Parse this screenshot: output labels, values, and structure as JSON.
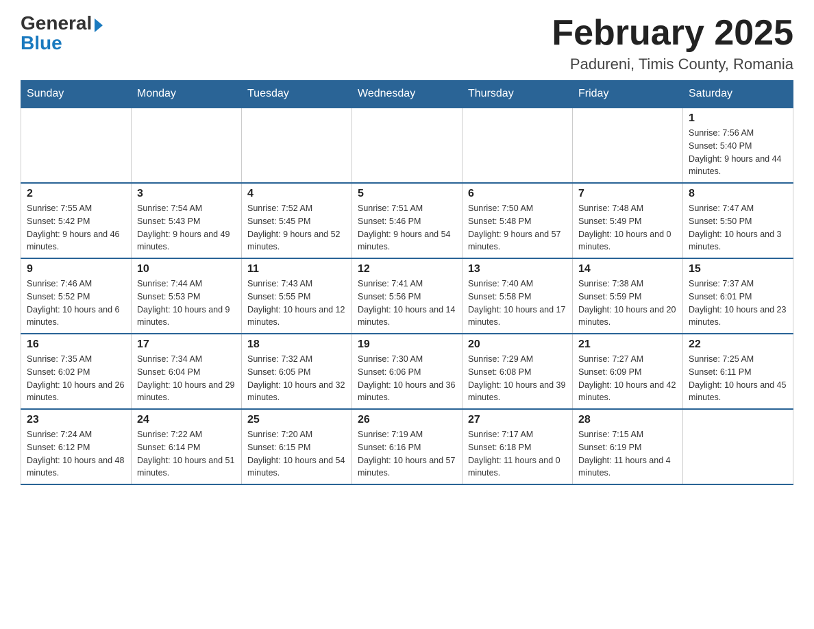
{
  "header": {
    "logo_general": "General",
    "logo_blue": "Blue",
    "month_year": "February 2025",
    "location": "Padureni, Timis County, Romania"
  },
  "weekdays": [
    "Sunday",
    "Monday",
    "Tuesday",
    "Wednesday",
    "Thursday",
    "Friday",
    "Saturday"
  ],
  "weeks": [
    [
      {
        "day": "",
        "info": ""
      },
      {
        "day": "",
        "info": ""
      },
      {
        "day": "",
        "info": ""
      },
      {
        "day": "",
        "info": ""
      },
      {
        "day": "",
        "info": ""
      },
      {
        "day": "",
        "info": ""
      },
      {
        "day": "1",
        "info": "Sunrise: 7:56 AM\nSunset: 5:40 PM\nDaylight: 9 hours and 44 minutes."
      }
    ],
    [
      {
        "day": "2",
        "info": "Sunrise: 7:55 AM\nSunset: 5:42 PM\nDaylight: 9 hours and 46 minutes."
      },
      {
        "day": "3",
        "info": "Sunrise: 7:54 AM\nSunset: 5:43 PM\nDaylight: 9 hours and 49 minutes."
      },
      {
        "day": "4",
        "info": "Sunrise: 7:52 AM\nSunset: 5:45 PM\nDaylight: 9 hours and 52 minutes."
      },
      {
        "day": "5",
        "info": "Sunrise: 7:51 AM\nSunset: 5:46 PM\nDaylight: 9 hours and 54 minutes."
      },
      {
        "day": "6",
        "info": "Sunrise: 7:50 AM\nSunset: 5:48 PM\nDaylight: 9 hours and 57 minutes."
      },
      {
        "day": "7",
        "info": "Sunrise: 7:48 AM\nSunset: 5:49 PM\nDaylight: 10 hours and 0 minutes."
      },
      {
        "day": "8",
        "info": "Sunrise: 7:47 AM\nSunset: 5:50 PM\nDaylight: 10 hours and 3 minutes."
      }
    ],
    [
      {
        "day": "9",
        "info": "Sunrise: 7:46 AM\nSunset: 5:52 PM\nDaylight: 10 hours and 6 minutes."
      },
      {
        "day": "10",
        "info": "Sunrise: 7:44 AM\nSunset: 5:53 PM\nDaylight: 10 hours and 9 minutes."
      },
      {
        "day": "11",
        "info": "Sunrise: 7:43 AM\nSunset: 5:55 PM\nDaylight: 10 hours and 12 minutes."
      },
      {
        "day": "12",
        "info": "Sunrise: 7:41 AM\nSunset: 5:56 PM\nDaylight: 10 hours and 14 minutes."
      },
      {
        "day": "13",
        "info": "Sunrise: 7:40 AM\nSunset: 5:58 PM\nDaylight: 10 hours and 17 minutes."
      },
      {
        "day": "14",
        "info": "Sunrise: 7:38 AM\nSunset: 5:59 PM\nDaylight: 10 hours and 20 minutes."
      },
      {
        "day": "15",
        "info": "Sunrise: 7:37 AM\nSunset: 6:01 PM\nDaylight: 10 hours and 23 minutes."
      }
    ],
    [
      {
        "day": "16",
        "info": "Sunrise: 7:35 AM\nSunset: 6:02 PM\nDaylight: 10 hours and 26 minutes."
      },
      {
        "day": "17",
        "info": "Sunrise: 7:34 AM\nSunset: 6:04 PM\nDaylight: 10 hours and 29 minutes."
      },
      {
        "day": "18",
        "info": "Sunrise: 7:32 AM\nSunset: 6:05 PM\nDaylight: 10 hours and 32 minutes."
      },
      {
        "day": "19",
        "info": "Sunrise: 7:30 AM\nSunset: 6:06 PM\nDaylight: 10 hours and 36 minutes."
      },
      {
        "day": "20",
        "info": "Sunrise: 7:29 AM\nSunset: 6:08 PM\nDaylight: 10 hours and 39 minutes."
      },
      {
        "day": "21",
        "info": "Sunrise: 7:27 AM\nSunset: 6:09 PM\nDaylight: 10 hours and 42 minutes."
      },
      {
        "day": "22",
        "info": "Sunrise: 7:25 AM\nSunset: 6:11 PM\nDaylight: 10 hours and 45 minutes."
      }
    ],
    [
      {
        "day": "23",
        "info": "Sunrise: 7:24 AM\nSunset: 6:12 PM\nDaylight: 10 hours and 48 minutes."
      },
      {
        "day": "24",
        "info": "Sunrise: 7:22 AM\nSunset: 6:14 PM\nDaylight: 10 hours and 51 minutes."
      },
      {
        "day": "25",
        "info": "Sunrise: 7:20 AM\nSunset: 6:15 PM\nDaylight: 10 hours and 54 minutes."
      },
      {
        "day": "26",
        "info": "Sunrise: 7:19 AM\nSunset: 6:16 PM\nDaylight: 10 hours and 57 minutes."
      },
      {
        "day": "27",
        "info": "Sunrise: 7:17 AM\nSunset: 6:18 PM\nDaylight: 11 hours and 0 minutes."
      },
      {
        "day": "28",
        "info": "Sunrise: 7:15 AM\nSunset: 6:19 PM\nDaylight: 11 hours and 4 minutes."
      },
      {
        "day": "",
        "info": ""
      }
    ]
  ]
}
